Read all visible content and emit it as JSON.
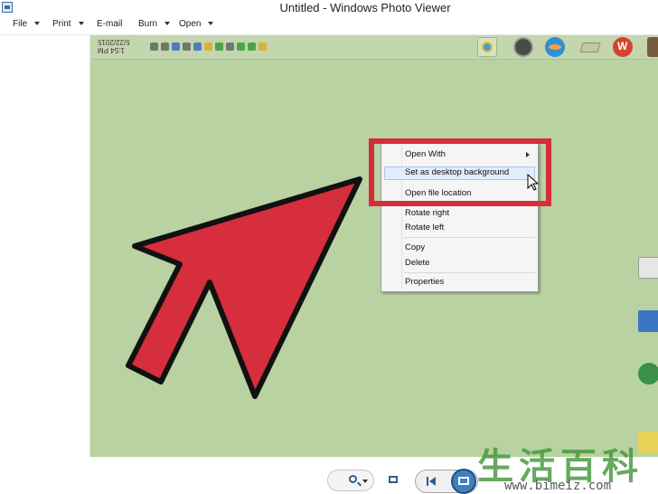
{
  "window": {
    "title": "Untitled - Windows Photo Viewer"
  },
  "menubar": {
    "items": [
      {
        "label": "File",
        "has_dropdown": true
      },
      {
        "label": "Print",
        "has_dropdown": true
      },
      {
        "label": "E-mail",
        "has_dropdown": false
      },
      {
        "label": "Burn",
        "has_dropdown": true
      },
      {
        "label": "Open",
        "has_dropdown": true
      }
    ]
  },
  "screenshot_content": {
    "clock_time": "1:54 PM",
    "clock_date": "5/22/2015",
    "background_color": "#b9d2a1"
  },
  "context_menu": {
    "items": [
      {
        "label": "Open With",
        "submenu": true
      },
      {
        "label": "Set as desktop background",
        "highlighted": true
      },
      {
        "label": "Open file location"
      },
      {
        "label": "Rotate right"
      },
      {
        "label": "Rotate left"
      },
      {
        "label": "Copy"
      },
      {
        "label": "Delete"
      },
      {
        "label": "Properties"
      }
    ]
  },
  "annotation": {
    "arrow_color": "#d62e3c",
    "box_color": "#d52d3a"
  },
  "toolbar": {
    "icons": [
      "zoom-icon",
      "fit-to-window-icon",
      "previous-icon",
      "slideshow-icon"
    ]
  },
  "watermark": {
    "chars": "生活百科",
    "url": "www.bimeiz.com"
  }
}
